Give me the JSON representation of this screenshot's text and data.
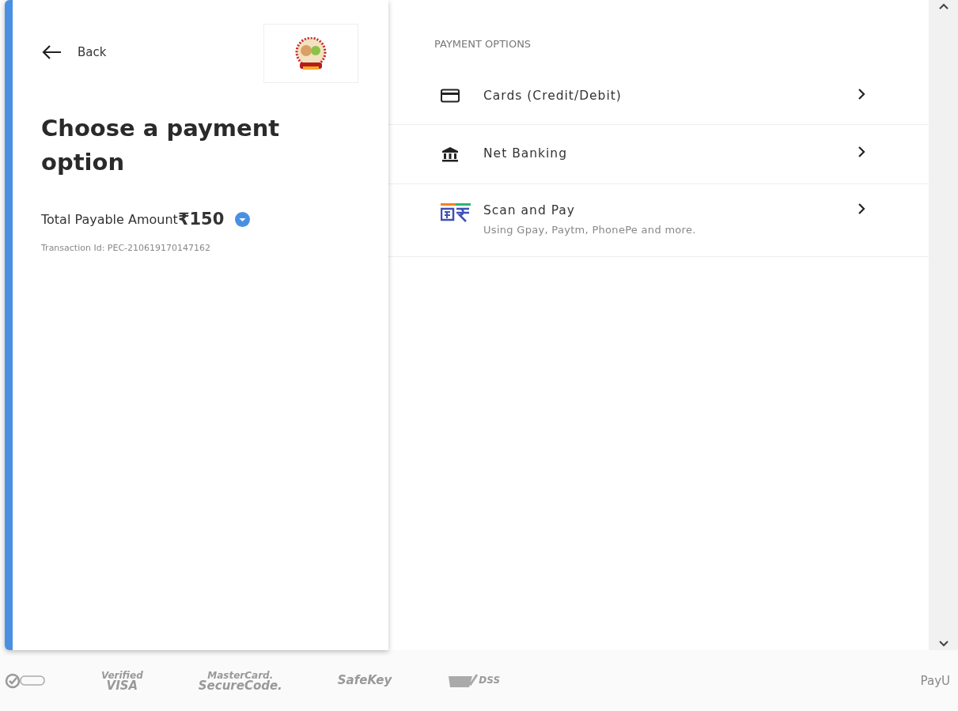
{
  "back": {
    "label": "Back"
  },
  "heading": "Choose a payment option",
  "amount": {
    "label": "Total Payable Amount",
    "value": "₹150"
  },
  "transaction": "Transaction Id: PEC-210619170147162",
  "options_title": "PAYMENT OPTIONS",
  "options": [
    {
      "kind": "card",
      "label": "Cards (Credit/Debit)"
    },
    {
      "kind": "bank",
      "label": "Net Banking"
    },
    {
      "kind": "upi",
      "label": "Scan and Pay",
      "subtitle": "Using Gpay, Paytm, PhonePe and more."
    }
  ],
  "footer": {
    "badges": [
      {
        "kind": "norton"
      },
      {
        "kind": "visa",
        "lines": [
          "Verified",
          "VISA"
        ]
      },
      {
        "kind": "mastercard",
        "lines": [
          "MasterCard.",
          "SecureCode."
        ]
      },
      {
        "kind": "safekey",
        "lines": [
          "SafeKey"
        ]
      },
      {
        "kind": "pci",
        "lines": [
          "DSS"
        ]
      }
    ],
    "brand": "PayU"
  }
}
